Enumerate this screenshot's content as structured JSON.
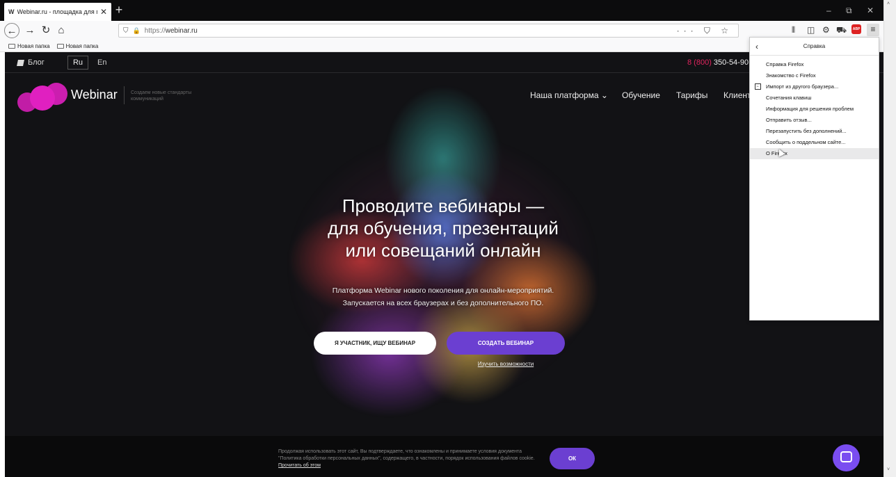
{
  "browser": {
    "tab_favicon": "W",
    "tab_title": "Webinar.ru - площадка для пр",
    "tab_close": "✕",
    "new_tab": "+",
    "window_controls": {
      "minimize": "–",
      "restore": "⧉",
      "close": "✕"
    },
    "url_scheme": "https://",
    "url_host": "webinar.ru",
    "url_actions": "··· ⛉ ☆",
    "bookmarks": [
      "Новая папка",
      "Новая папка"
    ]
  },
  "site": {
    "blog": "Блог",
    "lang_ru": "Ru",
    "lang_en": "En",
    "phone_code": "8 (800)",
    "phone_number": "350-54-90",
    "brand": "Webinar",
    "tagline": "Создаем новые стандарты коммуникаций",
    "nav": [
      "Наша платформа ⌄",
      "Обучение",
      "Тарифы",
      "Клиенты"
    ],
    "hero_title": [
      "Проводите вебинары —",
      "для обучения, презентаций",
      "или совещаний онлайн"
    ],
    "hero_sub": [
      "Платформа Webinar нового поколения для онлайн-мероприятий.",
      "Запускается на всех браузерах и без дополнительного ПО."
    ],
    "btn_participant": "Я УЧАСТНИК, ИЩУ ВЕБИНАР",
    "btn_create": "СОЗДАТЬ ВЕБИНАР",
    "learn_link": "Изучить возможности",
    "cookie_text": "Продолжая использовать этот сайт, Вы подтверждаете, что ознакомлены и принимаете условия документа \"Политика обработки персональных данных\", содержащего, в частности, порядок использования файлов cookie.",
    "cookie_link": "Прочитать об этом",
    "cookie_ok": "ОК",
    "accent_color": "#6b3fd1",
    "brand_color": "#e020c0"
  },
  "help_menu": {
    "title": "Справка",
    "items": [
      "Справка Firefox",
      "Знакомство с Firefox",
      "Импорт из другого браузера...",
      "Сочетания клавиш",
      "Информация для решения проблем",
      "Отправить отзыв...",
      "Перезапустить без дополнений...",
      "Сообщить о поддельном сайте...",
      "О Firefox"
    ]
  }
}
